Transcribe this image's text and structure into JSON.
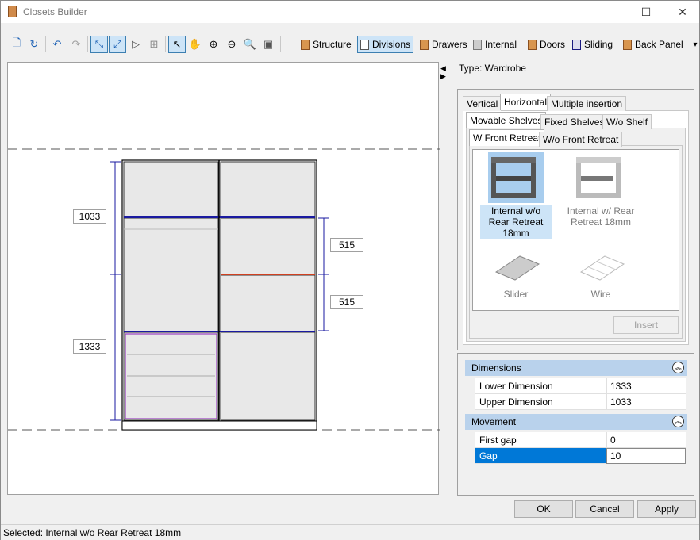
{
  "window": {
    "title": "Closets Builder",
    "minimize": "—",
    "maximize": "☐",
    "close": "✕"
  },
  "toolbar": {
    "structure": "Structure",
    "divisions": "Divisions",
    "drawers": "Drawers",
    "internal": "Internal",
    "doors": "Doors",
    "sliding": "Sliding",
    "back_panel": "Back Panel",
    "overflow": "▾"
  },
  "canvas": {
    "dims_left": [
      "1033",
      "1333"
    ],
    "dims_right": [
      "515",
      "515"
    ]
  },
  "type_label": "Type: Wardrobe",
  "tabs": {
    "level1": [
      "Vertical",
      "Horizontal",
      "Multiple insertion"
    ],
    "level2": [
      "Movable Shelves",
      "Fixed Shelves",
      "W/o Shelf"
    ],
    "level3": [
      "W Front Retreat",
      "W/o Front Retreat"
    ]
  },
  "items": [
    {
      "label": "Internal w/o Rear Retreat 18mm",
      "selected": true
    },
    {
      "label": "Internal w/ Rear Retreat 18mm",
      "selected": false
    },
    {
      "label": "Slider",
      "selected": false
    },
    {
      "label": "Wire",
      "selected": false
    }
  ],
  "insert_button": "Insert",
  "properties": {
    "dimensions": {
      "header": "Dimensions",
      "rows": [
        {
          "name": "Lower Dimension",
          "value": "1333"
        },
        {
          "name": "Upper Dimension",
          "value": "1033"
        }
      ]
    },
    "movement": {
      "header": "Movement",
      "rows": [
        {
          "name": "First gap",
          "value": "0"
        },
        {
          "name": "Gap",
          "value": "10"
        }
      ]
    }
  },
  "buttons": {
    "ok": "OK",
    "cancel": "Cancel",
    "apply": "Apply"
  },
  "status": "Selected: Internal w/o Rear Retreat 18mm",
  "colors": {
    "accent": "#0078d7",
    "selection": "#cde4f7",
    "group_header": "#b9d2ec",
    "division_line": "#1a1aa0",
    "highlight_line": "#d04020",
    "drawer_line": "#9a40c0"
  }
}
